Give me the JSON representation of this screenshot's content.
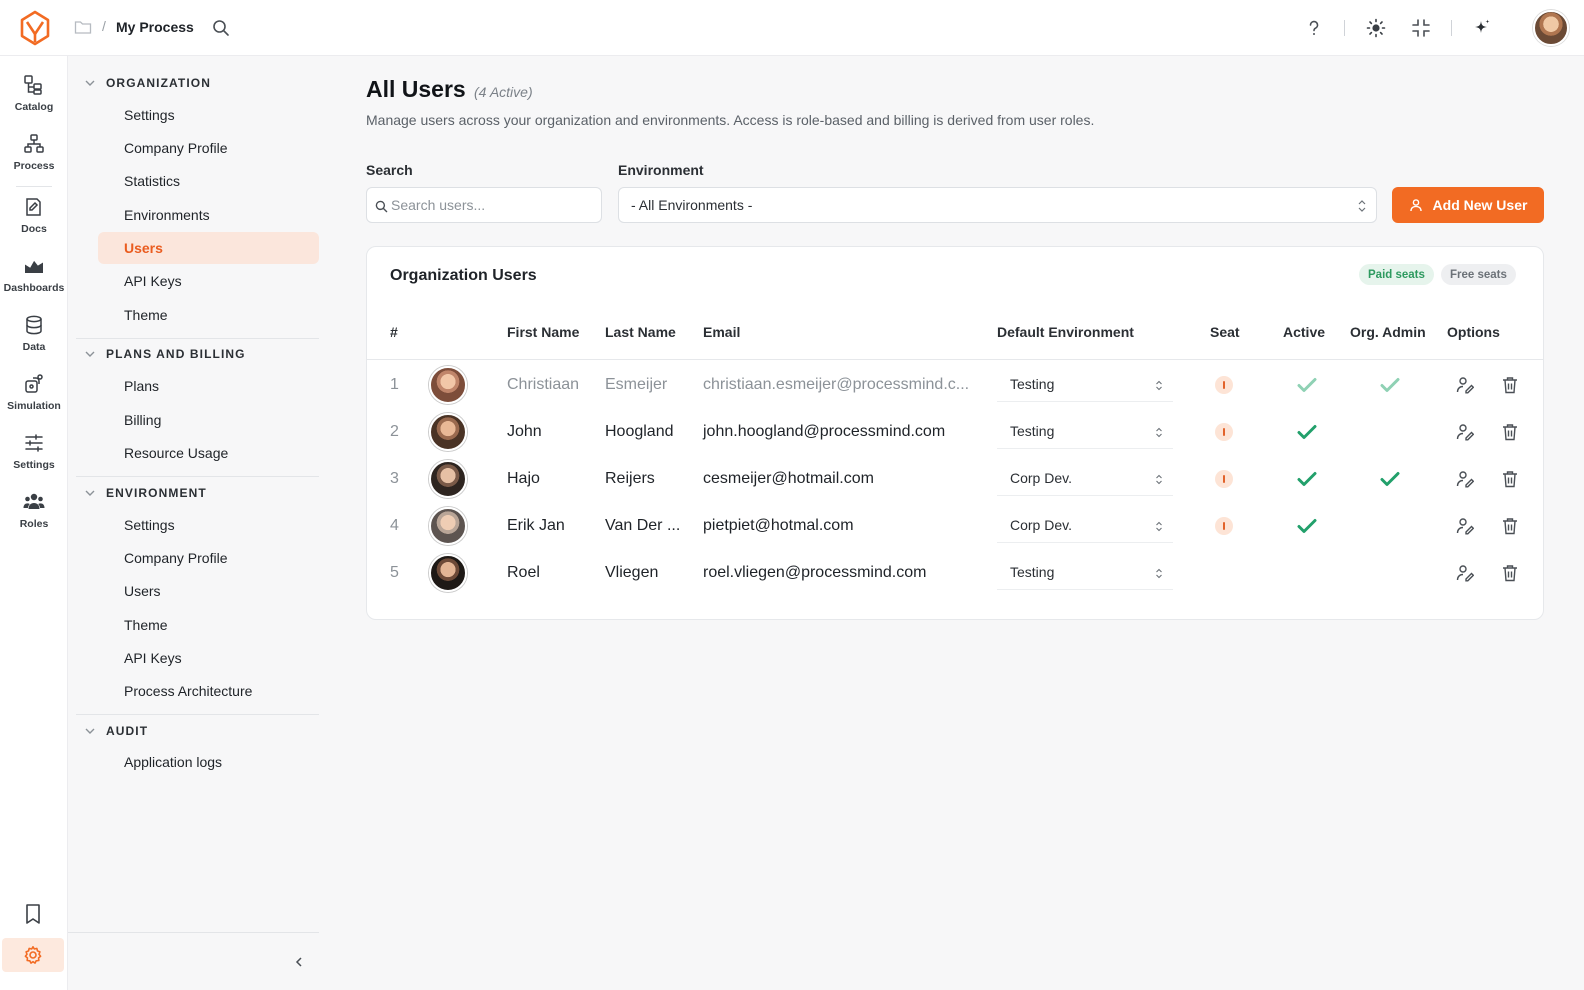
{
  "breadcrumb": {
    "title": "My Process"
  },
  "rail": [
    {
      "label": "Catalog",
      "icon": "catalog-icon"
    },
    {
      "label": "Process",
      "icon": "process-icon"
    },
    {
      "label": "Docs",
      "icon": "docs-icon"
    },
    {
      "label": "Dashboards",
      "icon": "dashboards-icon"
    },
    {
      "label": "Data",
      "icon": "database-icon"
    },
    {
      "label": "Simulation",
      "icon": "simulation-icon"
    },
    {
      "label": "Settings",
      "icon": "sliders-icon"
    },
    {
      "label": "Roles",
      "icon": "users-icon"
    }
  ],
  "nav": {
    "sections": [
      {
        "title": "ORGANIZATION",
        "items": [
          "Settings",
          "Company Profile",
          "Statistics",
          "Environments",
          "Users",
          "API Keys",
          "Theme"
        ]
      },
      {
        "title": "PLANS AND BILLING",
        "items": [
          "Plans",
          "Billing",
          "Resource Usage"
        ]
      },
      {
        "title": "ENVIRONMENT",
        "items": [
          "Settings",
          "Company Profile",
          "Users",
          "Theme",
          "API Keys",
          "Process Architecture"
        ]
      },
      {
        "title": "AUDIT",
        "items": [
          "Application logs"
        ]
      }
    ],
    "active": "ORGANIZATION / Users"
  },
  "page": {
    "title": "All Users",
    "count": "(4 Active)",
    "description": "Manage users across your organization and environments. Access is role-based and billing is derived from user roles."
  },
  "filters": {
    "search_label": "Search",
    "search_placeholder": "Search users...",
    "environment_label": "Environment",
    "environment_value": "- All Environments -",
    "add_button": "Add New User"
  },
  "table": {
    "title": "Organization Users",
    "pill_paid": "Paid seats",
    "pill_free": "Free seats",
    "columns": [
      "#",
      "First Name",
      "Last Name",
      "Email",
      "Default Environment",
      "Seat",
      "Active",
      "Org. Admin",
      "Options"
    ],
    "rows": [
      {
        "n": "1",
        "first": "Christiaan",
        "last": "Esmeijer",
        "email": "christiaan.esmeijer@processmind.c...",
        "env": "Testing",
        "seat": true,
        "active": true,
        "admin": true,
        "dim": true
      },
      {
        "n": "2",
        "first": "John",
        "last": "Hoogland",
        "email": "john.hoogland@processmind.com",
        "env": "Testing",
        "seat": true,
        "active": true,
        "admin": false,
        "dim": false
      },
      {
        "n": "3",
        "first": "Hajo",
        "last": "Reijers",
        "email": "cesmeijer@hotmail.com",
        "env": "Corp Dev.",
        "seat": true,
        "active": true,
        "admin": true,
        "dim": false
      },
      {
        "n": "4",
        "first": "Erik Jan",
        "last": "Van Der ...",
        "email": "pietpiet@hotmal.com",
        "env": "Corp Dev.",
        "seat": true,
        "active": true,
        "admin": false,
        "dim": false
      },
      {
        "n": "5",
        "first": "Roel",
        "last": "Vliegen",
        "email": "roel.vliegen@processmind.com",
        "env": "Testing",
        "seat": false,
        "active": false,
        "admin": false,
        "dim": false
      }
    ]
  },
  "colors": {
    "accent": "#f26b23",
    "active_nav_bg": "#fbe6dc",
    "check_green": "#22a06b",
    "paid_pill_bg": "#e6f4ec"
  }
}
